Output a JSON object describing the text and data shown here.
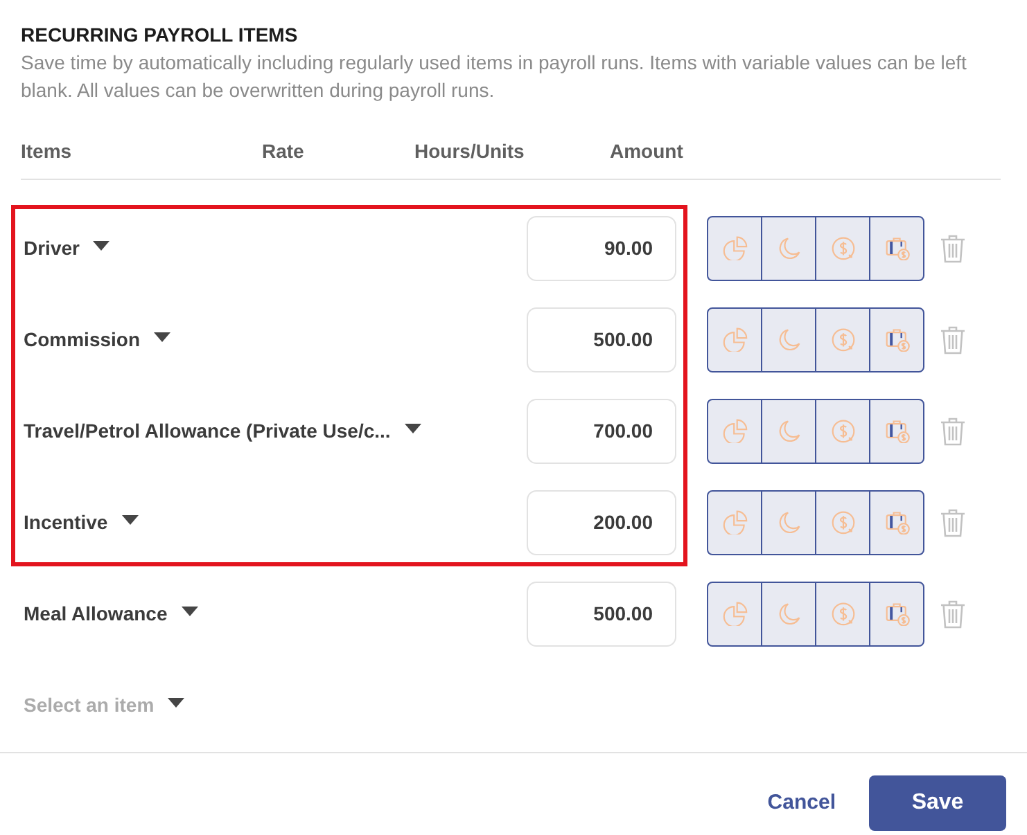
{
  "section": {
    "title": "RECURRING PAYROLL ITEMS",
    "description": "Save time by automatically including regularly used items in payroll runs. Items with variable values can be left blank. All values can be overwritten during payroll runs."
  },
  "table": {
    "columns": [
      "Items",
      "Rate",
      "Hours/Units",
      "Amount"
    ],
    "rows": [
      {
        "item": "Driver",
        "amount": "90.00",
        "highlighted": true
      },
      {
        "item": "Commission",
        "amount": "500.00",
        "highlighted": true
      },
      {
        "item": "Travel/Petrol Allowance (Private Use/c...",
        "amount": "700.00",
        "highlighted": true
      },
      {
        "item": "Incentive",
        "amount": "200.00",
        "highlighted": true
      },
      {
        "item": "Meal Allowance",
        "amount": "500.00",
        "highlighted": false
      }
    ],
    "new_row": {
      "placeholder": "Select an item"
    }
  },
  "footer": {
    "buttons": [
      {
        "label": "Cancel",
        "kind": "link"
      },
      {
        "label": "Save",
        "kind": "primary"
      }
    ]
  }
}
